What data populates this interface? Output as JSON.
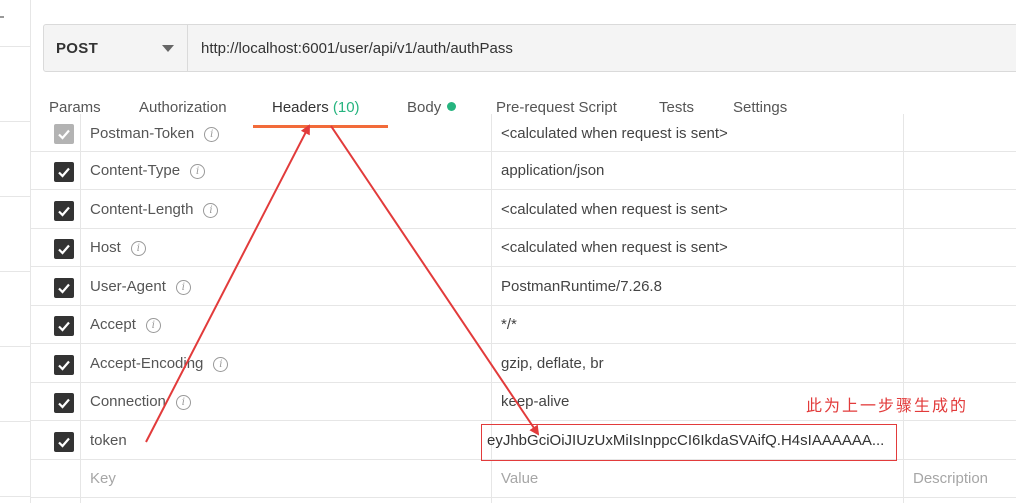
{
  "request": {
    "method": "POST",
    "url": "http://localhost:6001/user/api/v1/auth/authPass"
  },
  "tabs": [
    {
      "label": "Params"
    },
    {
      "label": "Authorization"
    },
    {
      "label": "Headers",
      "count": "(10)"
    },
    {
      "label": "Body"
    },
    {
      "label": "Pre-request Script"
    },
    {
      "label": "Tests"
    },
    {
      "label": "Settings"
    }
  ],
  "headers": [
    {
      "key": "Postman-Token",
      "value": "<calculated when request is sent>"
    },
    {
      "key": "Content-Type",
      "value": "application/json"
    },
    {
      "key": "Content-Length",
      "value": "<calculated when request is sent>"
    },
    {
      "key": "Host",
      "value": "<calculated when request is sent>"
    },
    {
      "key": "User-Agent",
      "value": "PostmanRuntime/7.26.8"
    },
    {
      "key": "Accept",
      "value": "*/*"
    },
    {
      "key": "Accept-Encoding",
      "value": "gzip, deflate, br"
    },
    {
      "key": "Connection",
      "value": "keep-alive"
    },
    {
      "key": "token",
      "value": "eyJhbGciOiJIUzUxMiIsInppcCI6IkdaSVAifQ.H4sIAAAAAA..."
    }
  ],
  "new_row": {
    "key": "Key",
    "value": "Value",
    "description": "Description"
  },
  "annotation": "此为上一步骤生成的",
  "colors": {
    "accent": "#f26b3a",
    "green": "#26b47f",
    "annotation_red": "#e23b3b"
  },
  "icons": {
    "check": "check-icon",
    "info": "info-icon",
    "caret": "chevron-down-icon"
  }
}
